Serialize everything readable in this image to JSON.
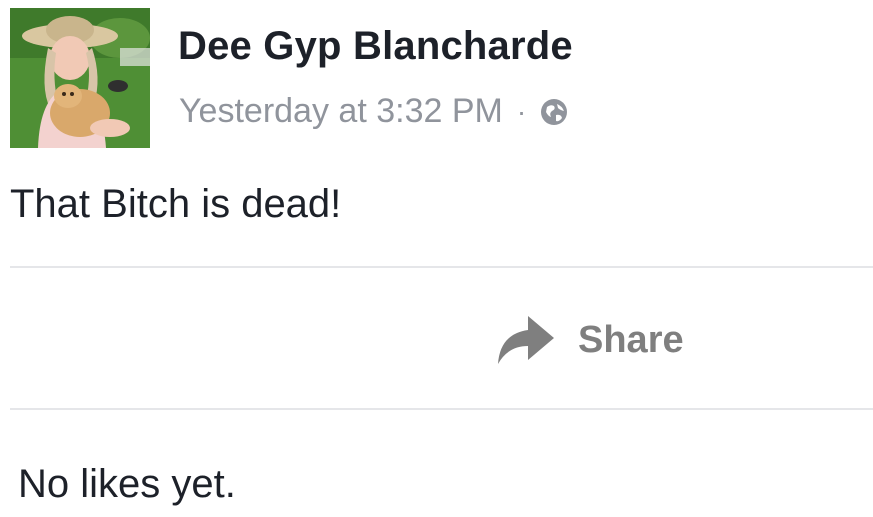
{
  "post": {
    "author": "Dee Gyp Blancharde",
    "timestamp": "Yesterday at 3:32 PM",
    "separator": "·",
    "privacy_icon": "globe-icon",
    "text": "That Bitch is dead!"
  },
  "actions": {
    "share_label": "Share",
    "share_icon": "share-arrow-icon"
  },
  "reactions": {
    "likes_text": "No likes yet."
  },
  "colors": {
    "name_text": "#1d2129",
    "meta_text": "#90949c",
    "share_text": "#7f7f7f",
    "divider": "#e5e6e9"
  }
}
